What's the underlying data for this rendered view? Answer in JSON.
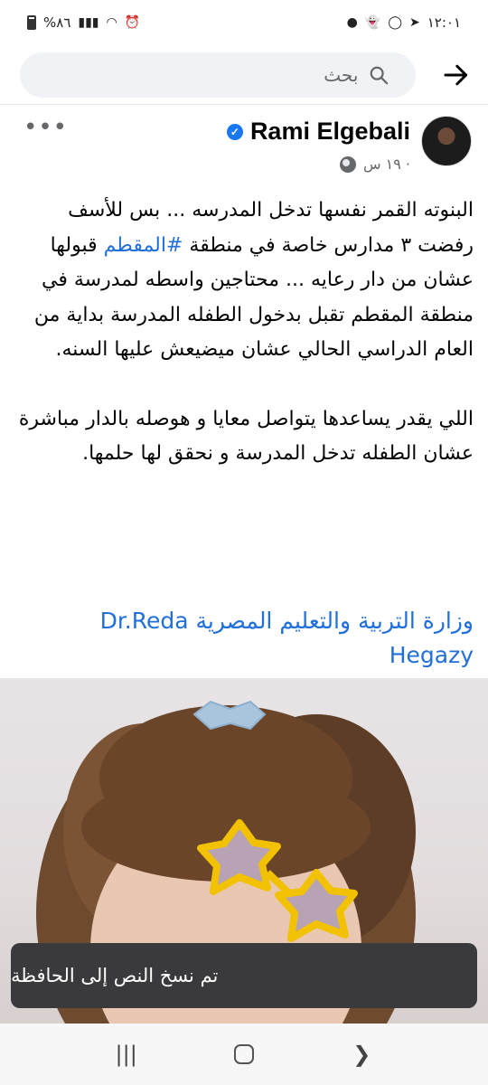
{
  "status_bar": {
    "time": "١٢:٠١",
    "battery": "%٨٦"
  },
  "search": {
    "placeholder": "بحث"
  },
  "post": {
    "author": "Rami Elgebali",
    "meta": "١٩ س ·",
    "paragraph_1_before_hashtag": "البنوته القمر نفسها تدخل المدرسه ... بس للأسف رفضت ٣ مدارس خاصة في منطقة ",
    "hashtag": "#المقطم",
    "paragraph_1_after_hashtag": " قبولها عشان من دار رعايه ... محتاجين واسطه لمدرسة في منطقة المقطم تقبل بدخول الطفله المدرسة بداية من العام الدراسي الحالي عشان ميضيعش عليها السنه.",
    "paragraph_2": "اللي يقدر يساعدها يتواصل معايا و هوصله بالدار مباشرة عشان الطفله تدخل المدرسة و نحقق لها حلمها.",
    "tag_ministry": "وزارة التربية والتعليم المصرية",
    "tag_person": "Dr.Reda Hegazy"
  },
  "toast": {
    "message": "تم نسخ النص إلى الحافظة"
  },
  "icons": {
    "back": "arrow-right-icon",
    "search": "search-icon",
    "verified": "verified-badge-icon",
    "audience": "globe-icon",
    "more": "more-options-icon",
    "nav_recents": "recents-icon",
    "nav_home": "home-icon",
    "nav_back": "back-chevron-icon"
  },
  "colors": {
    "link": "#216fdb",
    "verified": "#1877f2",
    "toast_bg": "#3a3a3c",
    "search_bg": "#f0f2f5"
  }
}
